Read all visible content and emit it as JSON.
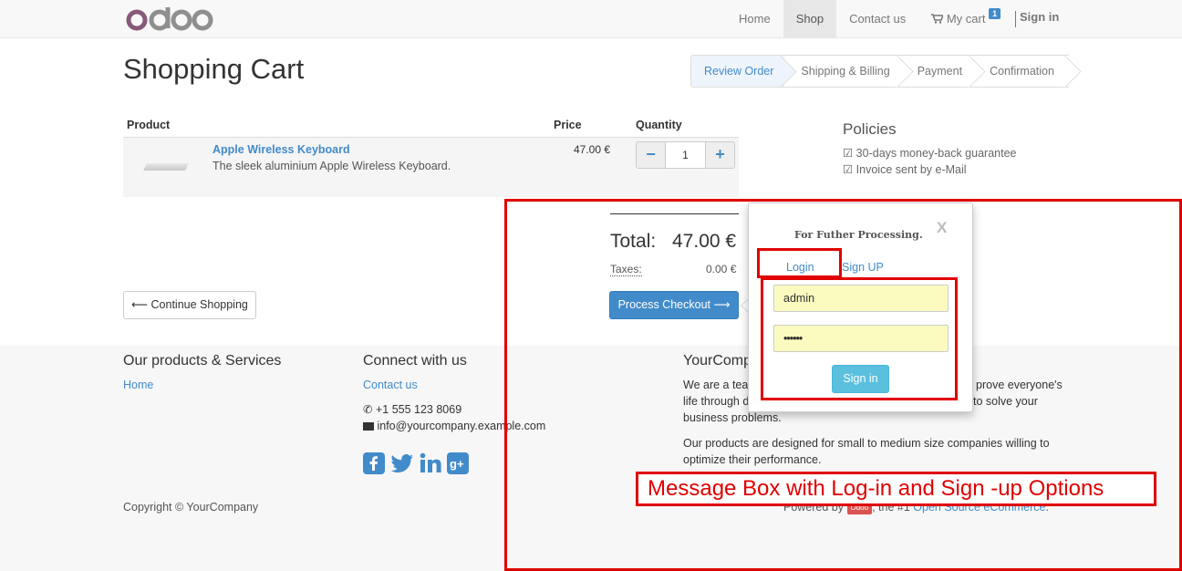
{
  "brand": {
    "logo_text": "odoo",
    "colors": {
      "purple": "#875a7b",
      "gray": "#8f8f8f"
    }
  },
  "nav": {
    "items": [
      "Home",
      "Shop",
      "Contact us"
    ],
    "active": "Shop",
    "cart_label": "My cart",
    "cart_count": "1",
    "signin_label": "Sign in"
  },
  "page": {
    "title": "Shopping Cart"
  },
  "wizard": {
    "steps": [
      "Review Order",
      "Shipping & Billing",
      "Payment",
      "Confirmation"
    ],
    "active": "Review Order"
  },
  "cart": {
    "columns": {
      "product": "Product",
      "price": "Price",
      "quantity": "Quantity"
    },
    "items": [
      {
        "name": "Apple Wireless Keyboard",
        "description": "The sleek aluminium Apple Wireless Keyboard.",
        "price": "47.00 €",
        "quantity": "1"
      }
    ],
    "minus_symbol": "−",
    "plus_symbol": "+"
  },
  "policies": {
    "title": "Policies",
    "items": [
      "☑ 30-days money-back guarantee",
      "☑ Invoice sent by e-Mail"
    ]
  },
  "totals": {
    "total_label": "Total:",
    "total_value": "47.00 €",
    "taxes_label": "Taxes:",
    "taxes_value": "0.00 €"
  },
  "buttons": {
    "checkout": "Process Checkout ⟶",
    "continue": "⟵ Continue Shopping"
  },
  "footer": {
    "products_title": "Our products & Services",
    "products_link": "Home",
    "connect_title": "Connect with us",
    "connect_link": "Contact us",
    "phone": "+1 555 123 8069",
    "email": "info@yourcompany.example.com",
    "company_title": "YourComp",
    "about_line1": "We are a tea",
    "about_line1_end": "prove everyone's",
    "about_line2": "life through d",
    "about_line2_end": "to solve your",
    "about_line3": "business problems.",
    "about_p2_line1": "Our products are designed for small to medium size companies willing to",
    "about_p2_line2": "optimize their performance.",
    "copyright": "Copyright © YourCompany",
    "powered_prefix": "Powered by",
    "powered_badge": "Odoo",
    "powered_mid": ", the #1",
    "powered_link": "Open Source eCommerce",
    "powered_end": "."
  },
  "popup": {
    "title": "For Futher Processing.",
    "close": "X",
    "tab_login": "Login",
    "tab_signup": "Sign UP",
    "username_value": "admin",
    "password_value": "••••••",
    "signin_button": "Sign in"
  },
  "annotation": {
    "caption": "Message Box with Log-in and Sign -up Options",
    "color": "#e00000"
  }
}
